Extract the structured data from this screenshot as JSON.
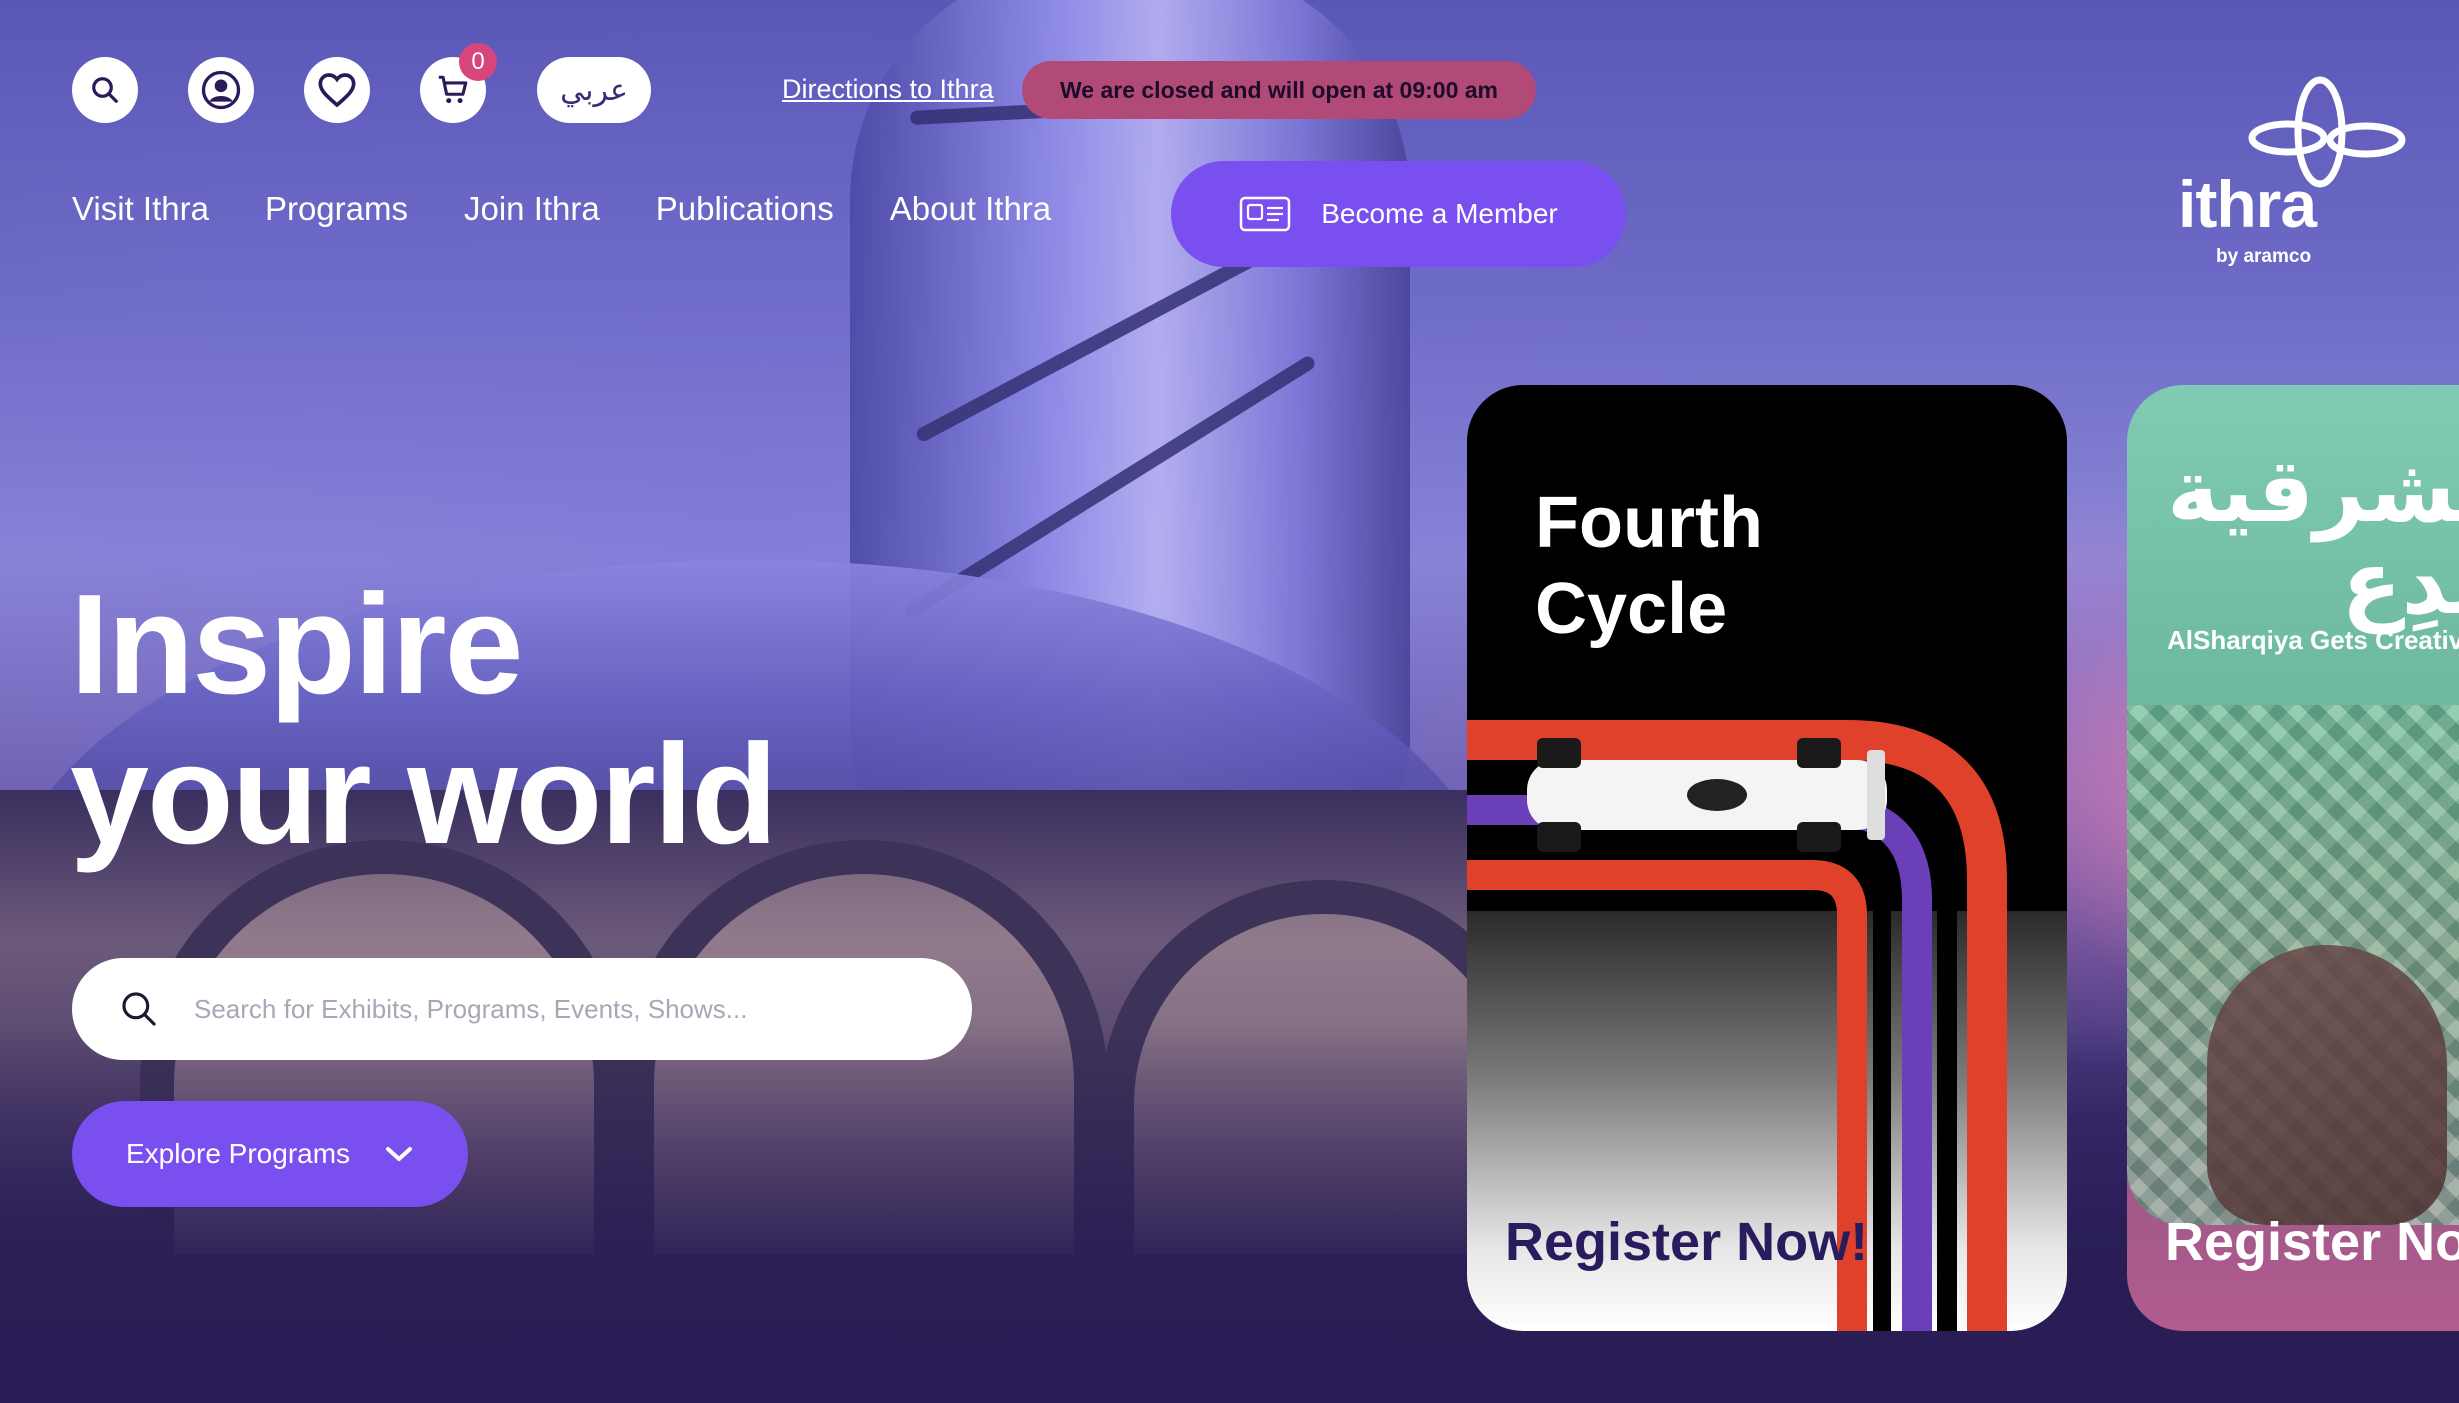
{
  "header": {
    "search_icon": "search-icon",
    "account_icon": "user-icon",
    "wishlist_icon": "heart-icon",
    "cart_icon": "cart-icon",
    "cart_count": "0",
    "language_label": "عربي",
    "directions_link": "Directions to Ithra",
    "status_text": "We are closed and will open at 09:00 am"
  },
  "nav": {
    "items": [
      {
        "label": "Visit Ithra"
      },
      {
        "label": "Programs"
      },
      {
        "label": "Join Ithra"
      },
      {
        "label": "Publications"
      },
      {
        "label": "About Ithra"
      }
    ],
    "member_button": "Become a Member"
  },
  "logo": {
    "word": "ithra",
    "sub": "by aramco"
  },
  "hero": {
    "title_line1": "Inspire",
    "title_line2": "your world",
    "search_placeholder": "Search for Exhibits, Programs, Events, Shows...",
    "explore_button": "Explore Programs"
  },
  "cards": [
    {
      "title_line1": "Fourth",
      "title_line2": "Cycle",
      "cta": "Register Now!"
    },
    {
      "title_ar_line1": "الشرقية",
      "title_ar_line2": "تبدِع",
      "subtitle": "AlSharqiya Gets Creative",
      "cta": "Register Now!"
    }
  ],
  "colors": {
    "accent": "#7a4ff0",
    "status_pill": "#b24a78",
    "badge": "#d6467c"
  }
}
